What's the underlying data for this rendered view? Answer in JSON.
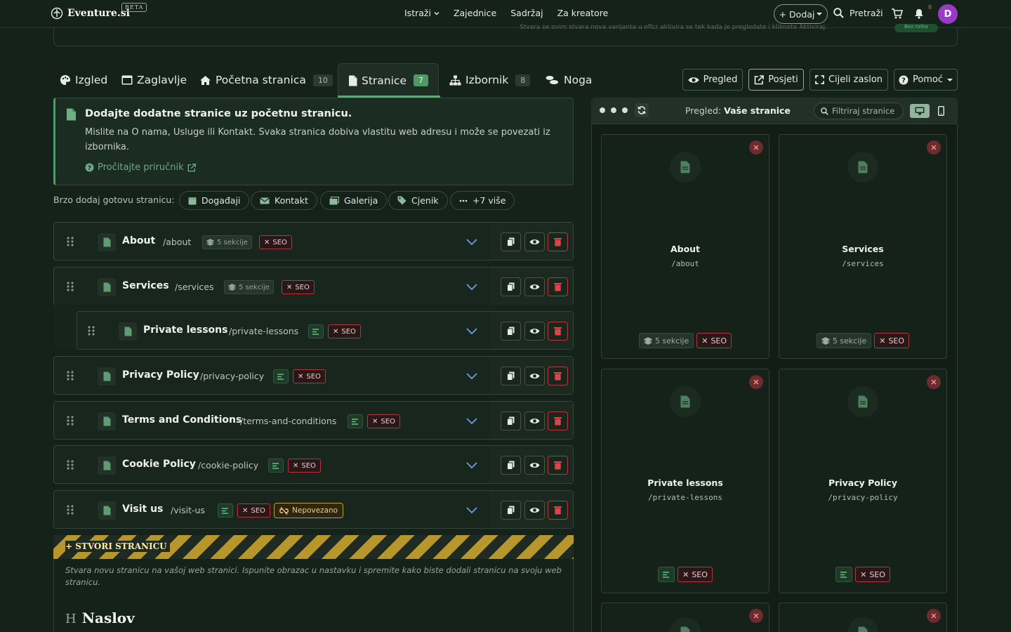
{
  "app": {
    "logo": "Eventure.si",
    "beta": "BETA"
  },
  "nav": {
    "links": [
      "Istraži",
      "Zajednice",
      "Sadržaj",
      "Za kreatore"
    ],
    "add_label": "+ Dodaj",
    "search_label": "Pretraži",
    "notif_count": "8",
    "avatar_initial": "D"
  },
  "infobar": {
    "text": "Stvara se ovim stvara nova varijanta u oflcr aktivira se tek kada je pregledate i kliknete Aktiviraj.",
    "pill": "Bez rizika"
  },
  "tabs": [
    {
      "label": "Izgled"
    },
    {
      "label": "Zaglavlje"
    },
    {
      "label": "Početna stranica",
      "count": "10"
    },
    {
      "label": "Stranice",
      "count": "7"
    },
    {
      "label": "Izbornik",
      "count": "8"
    },
    {
      "label": "Noga"
    }
  ],
  "toolbar": {
    "preview": "Pregled",
    "visit": "Posjeti",
    "fullscreen": "Cijeli zaslon",
    "help": "Pomoć"
  },
  "notice": {
    "title": "Dodajte dodatne stranice uz početnu stranicu.",
    "body": "Mislite na O nama, Usluge ili Kontakt. Svaka stranica dobiva vlastitu web adresu i može se povezati iz izbornika.",
    "link": "Pročitajte priručnik"
  },
  "quick_add": {
    "label": "Brzo dodaj gotovu stranicu:",
    "chips": [
      "Događaji",
      "Kontakt",
      "Galerija",
      "Cjenik",
      "+7 više"
    ]
  },
  "pages": [
    {
      "name": "About",
      "slug": "/about",
      "sections": "5 sekcije",
      "seo": "SEO"
    },
    {
      "name": "Services",
      "slug": "/services",
      "sections": "5 sekcije",
      "seo": "SEO"
    },
    {
      "name": "Private lessons",
      "slug": "/private-lessons",
      "seo": "SEO"
    },
    {
      "name": "Privacy Policy",
      "slug": "/privacy-policy",
      "seo": "SEO"
    },
    {
      "name": "Terms and Conditions",
      "slug": "/terms-and-conditions",
      "seo": "SEO"
    },
    {
      "name": "Cookie Policy",
      "slug": "/cookie-policy",
      "seo": "SEO"
    },
    {
      "name": "Visit us",
      "slug": "/visit-us",
      "seo": "SEO",
      "warning": "Nepovezano"
    }
  ],
  "create": {
    "label": "+ STVORI STRANICU",
    "description": "Stvara novu stranicu na vašoj web stranici. Ispunite obrazac u nastavku i spremite kako biste dodali stranicu na svoju web stranicu.",
    "field_heading": "Naslov",
    "field_prefix": "H"
  },
  "preview": {
    "title_prefix": "Pregled:",
    "title": "Vaše stranice",
    "filter_placeholder": "Filtriraj stranice",
    "cards": [
      {
        "name": "About",
        "slug": "/about",
        "sections": "5 sekcije",
        "seo": "SEO"
      },
      {
        "name": "Services",
        "slug": "/services",
        "sections": "5 sekcije",
        "seo": "SEO"
      },
      {
        "name": "Private lessons",
        "slug": "/private-lessons",
        "seo": "SEO"
      },
      {
        "name": "Privacy Policy",
        "slug": "/privacy-policy",
        "seo": "SEO"
      }
    ]
  },
  "colors": {
    "accent": "#5fa873",
    "danger": "#b5363b",
    "warning": "#c49a2a",
    "background": "#15221a"
  }
}
